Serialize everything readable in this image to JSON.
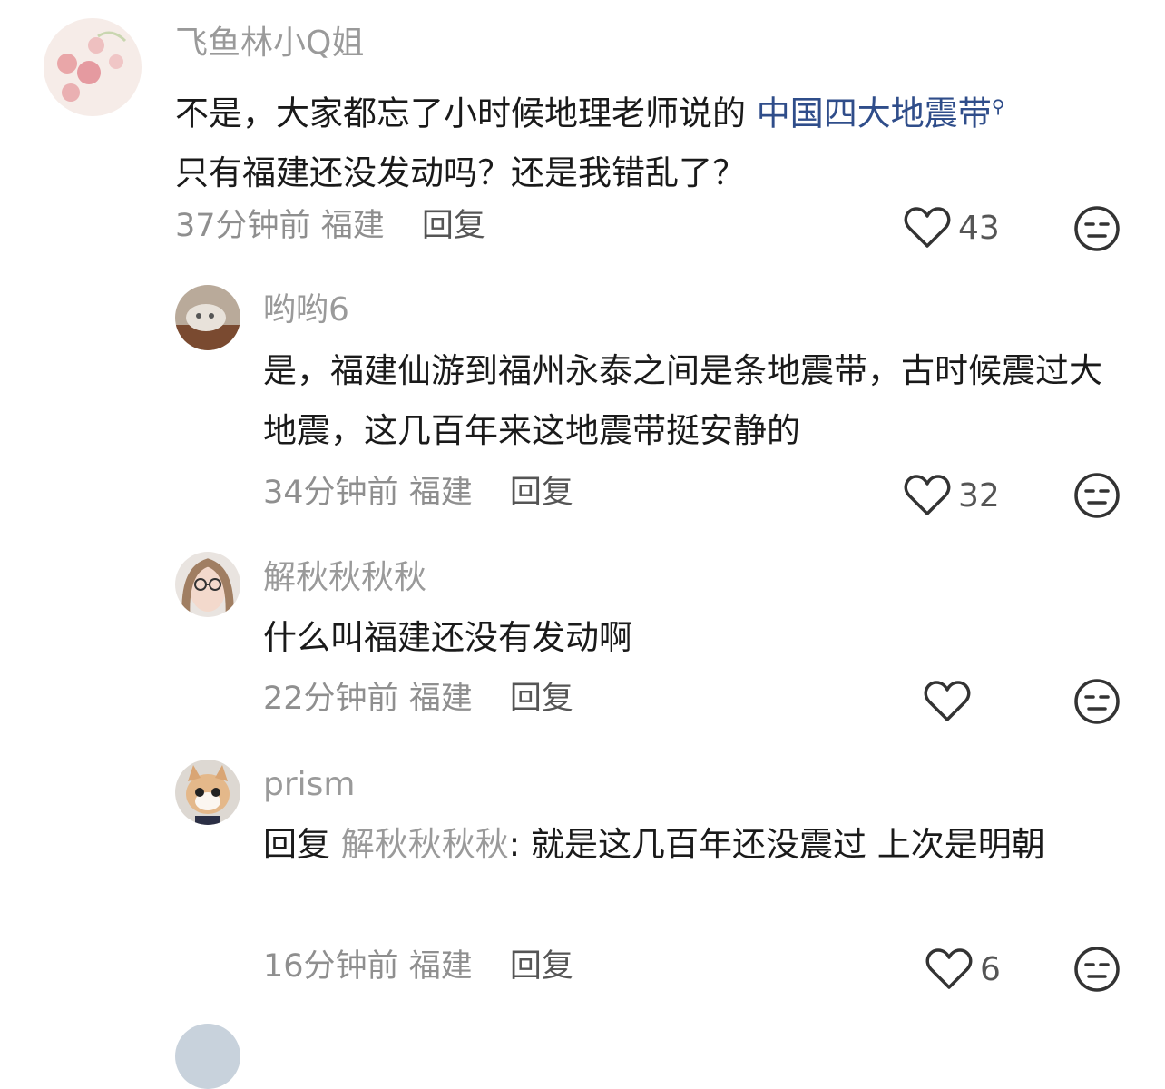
{
  "comments": [
    {
      "username": "飞鱼林小Q姐",
      "text_before": "不是，大家都忘了小时候地理老师说的 ",
      "topic": "中国四大地震带",
      "topic_mark": "⚲",
      "text_after": "只有福建还没发动吗？还是我错乱了？",
      "time": "37分钟前",
      "location": "福建",
      "reply_label": "回复",
      "likes": "43"
    },
    {
      "username": "哟哟6",
      "text": "是，福建仙游到福州永泰之间是条地震带，古时候震过大地震，这几百年来这地震带挺安静的",
      "time": "34分钟前",
      "location": "福建",
      "reply_label": "回复",
      "likes": "32"
    },
    {
      "username": "解秋秋秋秋",
      "text": "什么叫福建还没有发动啊",
      "time": "22分钟前",
      "location": "福建",
      "reply_label": "回复",
      "likes": ""
    },
    {
      "username": "prism",
      "reply_prefix": "回复 ",
      "reply_target": "解秋秋秋秋",
      "text": ": 就是这几百年还没震过 上次是明朝",
      "time": "16分钟前",
      "location": "福建",
      "reply_label": "回复",
      "likes": "6"
    }
  ],
  "icons": {
    "like": "heart-outline-icon",
    "dislike": "meh-face-icon"
  }
}
